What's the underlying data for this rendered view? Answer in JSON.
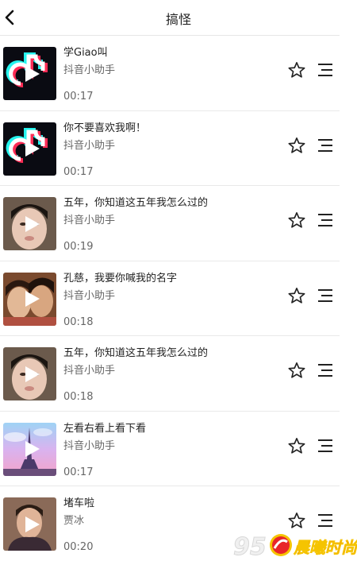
{
  "header": {
    "title": "搞怪",
    "back_icon": "chevron-left-icon"
  },
  "items": [
    {
      "title": "学Giao叫",
      "artist": "抖音小助手",
      "duration": "00:17",
      "thumb": "tiktok-logo"
    },
    {
      "title": "你不要喜欢我啊！",
      "artist": "抖音小助手",
      "duration": "00:17",
      "thumb": "tiktok-logo"
    },
    {
      "title": "五年，你知道这五年我怎么过的",
      "artist": "抖音小助手",
      "duration": "00:19",
      "thumb": "face-photo"
    },
    {
      "title": "孔慈，我要你喊我的名字",
      "artist": "抖音小助手",
      "duration": "00:18",
      "thumb": "couple-photo"
    },
    {
      "title": "五年，你知道这五年我怎么过的",
      "artist": "抖音小助手",
      "duration": "00:18",
      "thumb": "face-photo"
    },
    {
      "title": "左看右看上看下看",
      "artist": "抖音小助手",
      "duration": "00:17",
      "thumb": "eiffel-tower-photo"
    },
    {
      "title": "堵车啦",
      "artist": "贾冰",
      "duration": "00:20",
      "thumb": "man-photo"
    }
  ],
  "icons": {
    "favorite": "star-outline-icon",
    "menu": "playlist-menu-icon",
    "play": "play-icon"
  },
  "watermark": {
    "number": "95",
    "text": "晨曦时尚"
  },
  "colors": {
    "text": "#222222",
    "secondary": "#666666",
    "divider": "#e9e9e9",
    "watermark_red": "#e8262a",
    "watermark_yellow": "#f5c400"
  }
}
